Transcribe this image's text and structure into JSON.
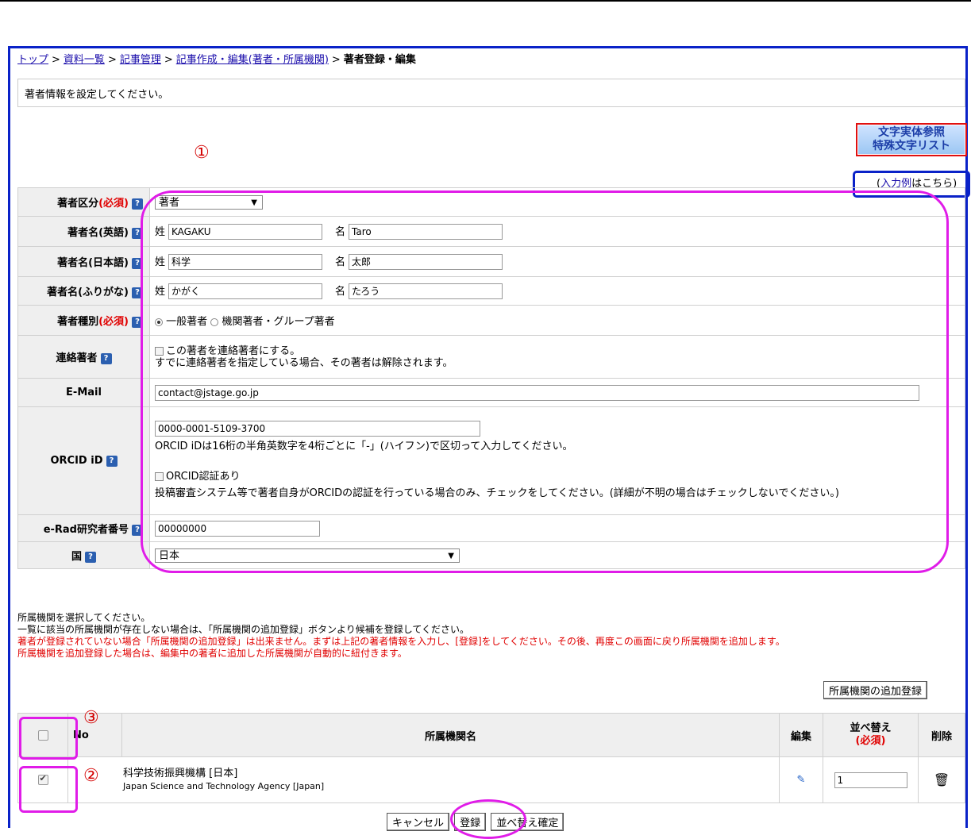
{
  "breadcrumb": {
    "items": [
      "トップ",
      "資料一覧",
      "記事管理",
      "記事作成・編集(著者・所属機関)"
    ],
    "separator": ">",
    "current": "著者登録・編集"
  },
  "message": "著者情報を設定してください。",
  "special_chars_button": {
    "line1": "文字実体参照",
    "line2": "特殊文字リスト"
  },
  "example_link": {
    "prefix": "(",
    "link": "入力例",
    "suffix": "はこちら)"
  },
  "annotations": {
    "one": "①",
    "two": "②",
    "three": "③"
  },
  "help_icon_text": "?",
  "form": {
    "author_type": {
      "label": "著者区分",
      "required": "(必須)",
      "value": "著者"
    },
    "name_en": {
      "label": "著者名(英語)",
      "last_prefix": "姓",
      "last": "KAGAKU",
      "first_prefix": "名",
      "first": "Taro"
    },
    "name_ja": {
      "label": "著者名(日本語)",
      "last_prefix": "姓",
      "last": "科学",
      "first_prefix": "名",
      "first": "太郎"
    },
    "name_kana": {
      "label": "著者名(ふりがな)",
      "last_prefix": "姓",
      "last": "かがく",
      "first_prefix": "名",
      "first": "たろう"
    },
    "author_kind": {
      "label": "著者種別",
      "required": "(必須)",
      "opt1": "一般著者",
      "opt2": "機関著者・グループ著者",
      "selected": "一般著者"
    },
    "contact": {
      "label": "連絡著者",
      "checkbox": "この著者を連絡著者にする。",
      "note": "すでに連絡著者を指定している場合、その著者は解除されます。"
    },
    "email": {
      "label": "E-Mail",
      "value": "contact@jstage.go.jp"
    },
    "orcid": {
      "label": "ORCID iD",
      "value": "0000-0001-5109-3700",
      "hint": "ORCID iDは16桁の半角英数字を4桁ごとに「-」(ハイフン)で区切って入力してください。",
      "auth_checkbox": "ORCID認証あり",
      "auth_note": "投稿審査システム等で著者自身がORCIDの認証を行っている場合のみ、チェックをしてください。(詳細が不明の場合はチェックしないでください。)"
    },
    "erad": {
      "label": "e-Rad研究者番号",
      "value": "00000000"
    },
    "country": {
      "label": "国",
      "value": "日本"
    }
  },
  "affiliation_notes": {
    "line1": "所属機関を選択してください。",
    "line2": "一覧に該当の所属機関が存在しない場合は、「所属機関の追加登録」ボタンより候補を登録してください。",
    "line3": "著者が登録されていない場合「所属機関の追加登録」は出来ません。まずは上記の著者情報を入力し、[登録]をしてください。その後、再度この画面に戻り所属機関を追加します。",
    "line4": "所属機関を追加登録した場合は、編集中の著者に追加した所属機関が自動的に紐付きます。"
  },
  "add_affiliation_button": "所属機関の追加登録",
  "affiliation_table": {
    "headers": {
      "no": "No",
      "name": "所属機関名",
      "edit": "編集",
      "sort": "並べ替え",
      "sort_required": "(必須)",
      "delete": "削除"
    },
    "rows": [
      {
        "checked": true,
        "name_ja": "科学技術振興機構 [日本]",
        "name_en": "Japan Science and Technology Agency [Japan]",
        "order": "1"
      }
    ]
  },
  "buttons": {
    "cancel": "キャンセル",
    "register": "登録",
    "confirm_sort": "並べ替え確定"
  },
  "colors": {
    "required": "#e00000",
    "annotation": "#e01ce8",
    "frame": "#0a22c8",
    "link": "#1a0dab"
  }
}
